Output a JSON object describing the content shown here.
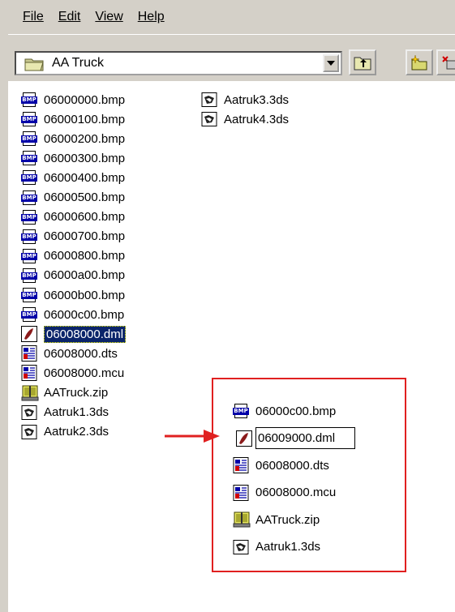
{
  "menu": [
    "File",
    "Edit",
    "View",
    "Help"
  ],
  "address": {
    "label": "AA Truck"
  },
  "colors": {
    "selection": "#0a246a",
    "highlight_box": "#e02020",
    "arrow": "#e02020"
  },
  "files_col1": [
    {
      "name": "06000000.bmp",
      "icon": "bmp-icon"
    },
    {
      "name": "06000100.bmp",
      "icon": "bmp-icon"
    },
    {
      "name": "06000200.bmp",
      "icon": "bmp-icon"
    },
    {
      "name": "06000300.bmp",
      "icon": "bmp-icon"
    },
    {
      "name": "06000400.bmp",
      "icon": "bmp-icon"
    },
    {
      "name": "06000500.bmp",
      "icon": "bmp-icon"
    },
    {
      "name": "06000600.bmp",
      "icon": "bmp-icon"
    },
    {
      "name": "06000700.bmp",
      "icon": "bmp-icon"
    },
    {
      "name": "06000800.bmp",
      "icon": "bmp-icon"
    },
    {
      "name": "06000a00.bmp",
      "icon": "bmp-icon"
    },
    {
      "name": "06000b00.bmp",
      "icon": "bmp-icon"
    },
    {
      "name": "06000c00.bmp",
      "icon": "bmp-icon"
    },
    {
      "name": "06008000.dml",
      "icon": "dml-icon",
      "selected": true
    },
    {
      "name": "06008000.dts",
      "icon": "dts-icon"
    },
    {
      "name": "06008000.mcu",
      "icon": "mcu-icon"
    },
    {
      "name": "AATruck.zip",
      "icon": "zip-icon"
    },
    {
      "name": "Aatruk1.3ds",
      "icon": "3ds-icon"
    },
    {
      "name": "Aatruk2.3ds",
      "icon": "3ds-icon"
    }
  ],
  "files_col2": [
    {
      "name": "Aatruk3.3ds",
      "icon": "3ds-icon"
    },
    {
      "name": "Aatruk4.3ds",
      "icon": "3ds-icon"
    }
  ],
  "inset_files": [
    {
      "name": "06000c00.bmp",
      "icon": "bmp-icon"
    },
    {
      "name": "06009000.dml",
      "icon": "dml-icon",
      "renaming": true
    },
    {
      "name": "06008000.dts",
      "icon": "dts-icon"
    },
    {
      "name": "06008000.mcu",
      "icon": "mcu-icon"
    },
    {
      "name": "AATruck.zip",
      "icon": "zip-icon"
    },
    {
      "name": "Aatruk1.3ds",
      "icon": "3ds-icon"
    }
  ]
}
